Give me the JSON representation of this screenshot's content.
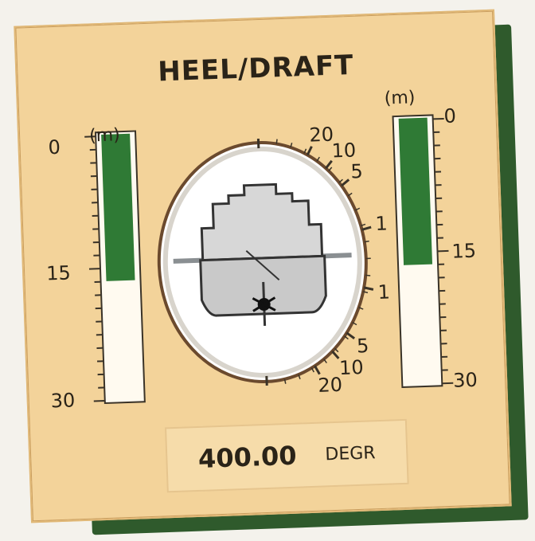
{
  "panel": {
    "title": "HEEL/DRAFT"
  },
  "left_gauge": {
    "unit": "(m)",
    "labels": [
      "0",
      "15",
      "30"
    ],
    "level_fraction": 0.55,
    "fill_color": "#2f7a35"
  },
  "right_gauge": {
    "unit": "(m)",
    "labels": [
      "0",
      "15",
      "30"
    ],
    "level_fraction": 0.55,
    "fill_color": "#2f7a35"
  },
  "heel_indicator": {
    "scale_labels_right": [
      "20",
      "10",
      "5",
      "1",
      "1",
      "5",
      "10",
      "20"
    ],
    "heel_angle_deg": 0
  },
  "readout": {
    "value": "400.00",
    "unit": "DEGR"
  }
}
